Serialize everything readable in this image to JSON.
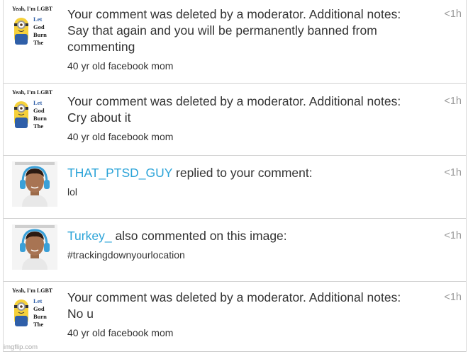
{
  "notifications": [
    {
      "type": "moderation",
      "avatar_text": [
        "Yeah, I'm LGBT",
        "Let",
        "God",
        "Burn",
        "The"
      ],
      "title": "Your comment was deleted by a moderator. Additional notes: Say that again and you will be permanently banned from commenting",
      "sub": "40 yr old facebook mom",
      "time": "<1h"
    },
    {
      "type": "moderation",
      "avatar_text": [
        "Yeah, I'm LGBT",
        "Let",
        "God",
        "Burn",
        "The"
      ],
      "title": "Your comment was deleted by a moderator. Additional notes: Cry about it",
      "sub": "40 yr old facebook mom",
      "time": "<1h"
    },
    {
      "type": "reply",
      "user": "THAT_PTSD_GUY",
      "action": " replied to your comment:",
      "sub": "lol",
      "time": "<1h"
    },
    {
      "type": "reply",
      "user": "Turkey_",
      "action": " also commented on this image:",
      "sub": "#trackingdownyourlocation",
      "time": "<1h"
    },
    {
      "type": "moderation",
      "avatar_text": [
        "Yeah, I'm LGBT",
        "Let",
        "God",
        "Burn",
        "The"
      ],
      "title": "Your comment was deleted by a moderator. Additional notes: No u",
      "sub": "40 yr old facebook mom",
      "time": "<1h"
    }
  ],
  "watermark": "imgflip.com",
  "colors": {
    "username": "#2aa3d8",
    "text": "#333333",
    "time": "#9a9a9a"
  }
}
